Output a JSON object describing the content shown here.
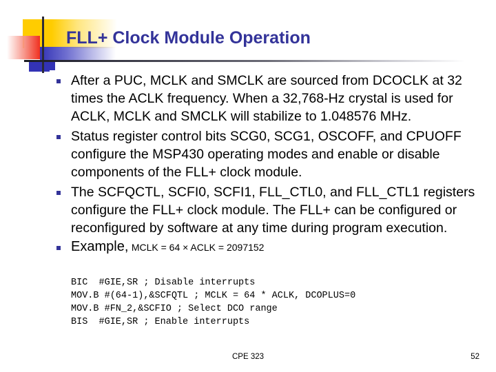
{
  "slide": {
    "title": "FLL+ Clock Module Operation",
    "accent_title_color": "#333399",
    "bullet_color": "#333399",
    "deco_yellow": "#FFCC00",
    "deco_red": "#F03020",
    "deco_blue": "#3333B5",
    "deco_line": "#2b2b38"
  },
  "bullets": [
    {
      "text": "After a PUC, MCLK and SMCLK are sourced from DCOCLK at 32 times the ACLK frequency. When a 32,768-Hz crystal is used for ACLK, MCLK and SMCLK will stabilize to 1.048576 MHz."
    },
    {
      "text": "Status register control bits SCG0, SCG1, OSCOFF, and CPUOFF configure the MSP430 operating modes and enable or disable components of the FLL+ clock module."
    },
    {
      "text": "The SCFQCTL, SCFI0, SCFI1, FLL_CTL0, and FLL_CTL1 registers configure the FLL+ clock module. The FLL+ can be configured or reconfigured by software at any time during program execution."
    }
  ],
  "example": {
    "lead": "Example,",
    "formula": "MCLK = 64 × ACLK = 2097152",
    "code": "BIC  #GIE,SR ; Disable interrupts\nMOV.B #(64-1),&SCFQTL ; MCLK = 64 * ACLK, DCOPLUS=0\nMOV.B #FN_2,&SCFIO ; Select DCO range\nBIS  #GIE,SR ; Enable interrupts"
  },
  "footer": {
    "course": "CPE 323",
    "page_number": "52"
  }
}
